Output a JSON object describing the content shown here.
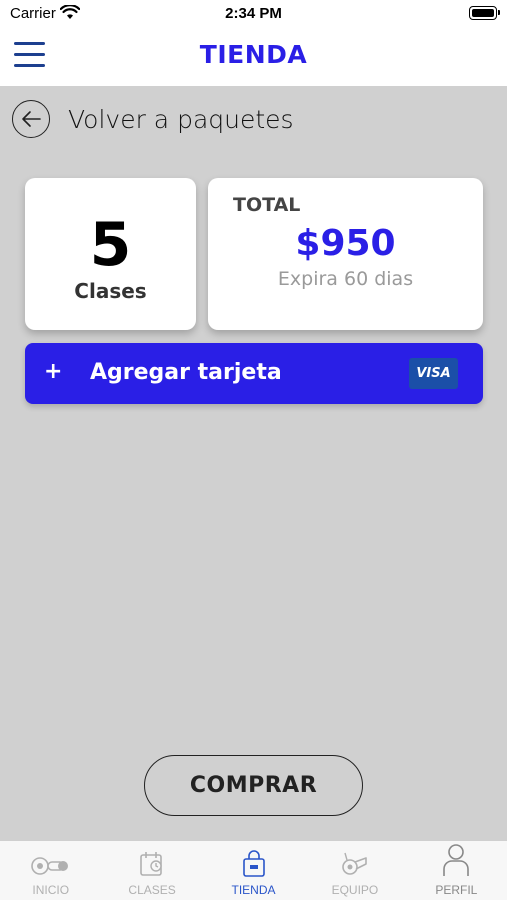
{
  "status_bar": {
    "carrier": "Carrier",
    "time": "2:34 PM"
  },
  "header": {
    "title": "TIENDA"
  },
  "back": {
    "label": "Volver a paquetes"
  },
  "package": {
    "classes_count": "5",
    "classes_label": "Clases",
    "total_label": "TOTAL",
    "total_amount": "$950",
    "expiry": "Expira 60 dias"
  },
  "payment": {
    "plus": "+",
    "add_card_label": "Agregar tarjeta",
    "card_brand": "VISA"
  },
  "actions": {
    "buy_label": "COMPRAR"
  },
  "tabs": [
    {
      "label": "INICIO",
      "icon": "whistle-home-icon"
    },
    {
      "label": "CLASES",
      "icon": "calendar-icon"
    },
    {
      "label": "TIENDA",
      "icon": "shopping-bag-icon"
    },
    {
      "label": "EQUIPO",
      "icon": "whistle-icon"
    },
    {
      "label": "PERFIL",
      "icon": "user-icon"
    }
  ],
  "colors": {
    "accent": "#2a1fe6",
    "nav_icon": "#1d3f8f",
    "background": "#d0d0d0",
    "visa_badge": "#1b4fa8",
    "tab_active": "#2a55c9"
  }
}
